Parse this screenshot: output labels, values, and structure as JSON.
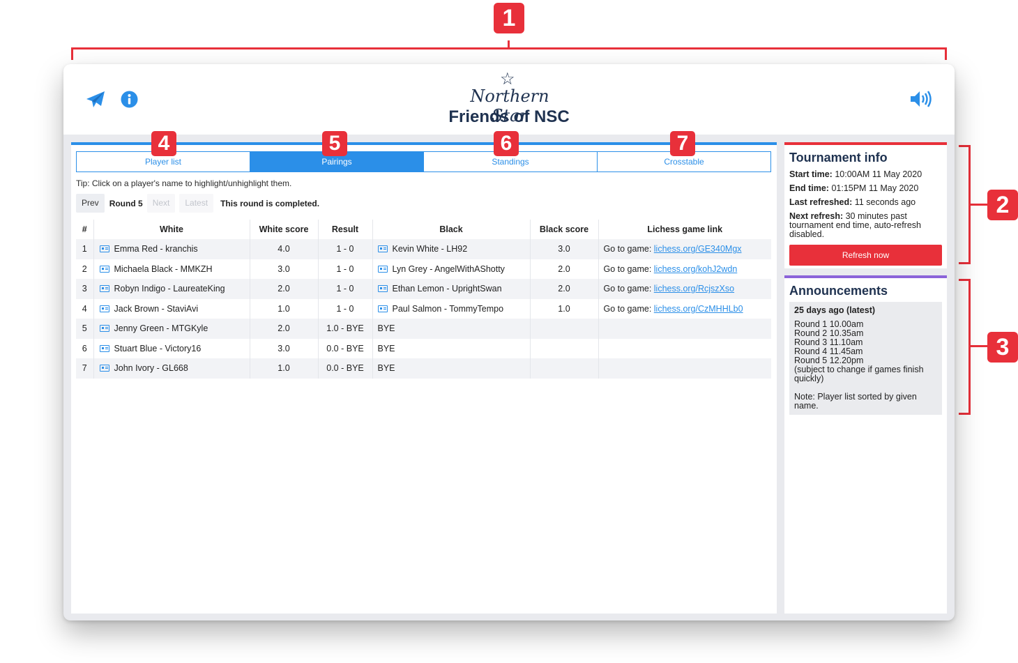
{
  "annotations": [
    "1",
    "2",
    "3",
    "4",
    "5",
    "6",
    "7"
  ],
  "header": {
    "logo_text": "Northern Star",
    "title": "Friends of NSC",
    "icons": [
      "paper-plane-icon",
      "info-icon",
      "speaker-icon"
    ]
  },
  "tabs": [
    "Player list",
    "Pairings",
    "Standings",
    "Crosstable"
  ],
  "active_tab": "Pairings",
  "tip": "Tip: Click on a player's name to highlight/unhighlight them.",
  "round_nav": {
    "prev": "Prev",
    "round": "Round 5",
    "next": "Next",
    "latest": "Latest",
    "status": "This round is completed."
  },
  "pairings": {
    "columns": [
      "#",
      "White",
      "White score",
      "Result",
      "Black",
      "Black score",
      "Lichess game link"
    ],
    "rows": [
      {
        "num": "1",
        "white": "Emma Red - kranchis",
        "white_score": "4.0",
        "result": "1 - 0",
        "black": "Kevin White - LH92",
        "black_score": "3.0",
        "link_prefix": "Go to game: ",
        "link": "lichess.org/GE340Mgx"
      },
      {
        "num": "2",
        "white": "Michaela Black - MMKZH",
        "white_score": "3.0",
        "result": "1 - 0",
        "black": "Lyn Grey - AngelWithAShotty",
        "black_score": "2.0",
        "link_prefix": "Go to game: ",
        "link": "lichess.org/kohJ2wdn"
      },
      {
        "num": "3",
        "white": "Robyn Indigo - LaureateKing",
        "white_score": "2.0",
        "result": "1 - 0",
        "black": "Ethan Lemon - UprightSwan",
        "black_score": "2.0",
        "link_prefix": "Go to game: ",
        "link": "lichess.org/RcjszXso"
      },
      {
        "num": "4",
        "white": "Jack Brown - StaviAvi",
        "white_score": "1.0",
        "result": "1 - 0",
        "black": "Paul Salmon - TommyTempo",
        "black_score": "1.0",
        "link_prefix": "Go to game: ",
        "link": "lichess.org/CzMHHLb0"
      },
      {
        "num": "5",
        "white": "Jenny Green - MTGKyle",
        "white_score": "2.0",
        "result": "1.0 - BYE",
        "black": "BYE",
        "black_score": "",
        "link_prefix": "",
        "link": ""
      },
      {
        "num": "6",
        "white": "Stuart Blue - Victory16",
        "white_score": "3.0",
        "result": "0.0 - BYE",
        "black": "BYE",
        "black_score": "",
        "link_prefix": "",
        "link": ""
      },
      {
        "num": "7",
        "white": "John Ivory - GL668",
        "white_score": "1.0",
        "result": "0.0 - BYE",
        "black": "BYE",
        "black_score": "",
        "link_prefix": "",
        "link": ""
      }
    ]
  },
  "tournament_info": {
    "title": "Tournament info",
    "start_label": "Start time:",
    "start_value": "10:00AM 11 May 2020",
    "end_label": "End time:",
    "end_value": "01:15PM 11 May 2020",
    "refreshed_label": "Last refreshed:",
    "refreshed_value": "11 seconds ago",
    "next_label": "Next refresh:",
    "next_value": "30 minutes past tournament end time, auto-refresh disabled.",
    "refresh_button": "Refresh now"
  },
  "announcements": {
    "title": "Announcements",
    "heading": "25 days ago (latest)",
    "lines": [
      "Round 1 10.00am",
      "Round 2 10.35am",
      "Round 3 11.10am",
      "Round 4 11.45am",
      "Round 5 12.20pm",
      "(subject to change if games finish quickly)"
    ],
    "note": "Note: Player list sorted by given name."
  },
  "colors": {
    "accent": "#2b8fe8",
    "danger": "#e8303a",
    "announce": "#8b63d9",
    "title": "#1f3250"
  }
}
